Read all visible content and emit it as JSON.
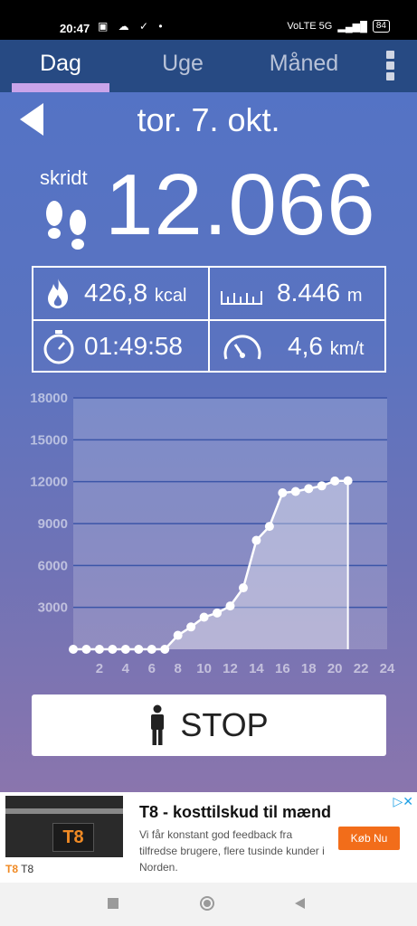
{
  "status_bar": {
    "time": "20:47",
    "left_icons": "▣ ☁ ✓ •",
    "network": "VoLTE 5G",
    "battery": "84"
  },
  "tabs": [
    {
      "label": "Dag",
      "active": true
    },
    {
      "label": "Uge",
      "active": false
    },
    {
      "label": "Måned",
      "active": false
    }
  ],
  "date": "tor. 7. okt.",
  "steps": {
    "label": "skridt",
    "value": "12.066"
  },
  "stats": {
    "calories": {
      "value": "426,8",
      "unit": "kcal"
    },
    "distance": {
      "value": "8.446",
      "unit": "m"
    },
    "duration": {
      "value": "01:49:58"
    },
    "speed": {
      "value": "4,6",
      "unit": "km/t"
    }
  },
  "chart_data": {
    "type": "area",
    "x": [
      0,
      1,
      2,
      3,
      4,
      5,
      6,
      7,
      8,
      9,
      10,
      11,
      12,
      13,
      14,
      15,
      16,
      17,
      18,
      19,
      20,
      21
    ],
    "y": [
      0,
      0,
      0,
      0,
      0,
      0,
      0,
      0,
      1000,
      1600,
      2300,
      2600,
      3100,
      4400,
      7800,
      8800,
      11200,
      11300,
      11500,
      11700,
      12050,
      12066
    ],
    "x_ticks": [
      "2",
      "4",
      "6",
      "8",
      "10",
      "12",
      "14",
      "16",
      "18",
      "20",
      "22",
      "24"
    ],
    "y_ticks": [
      "3000",
      "6000",
      "9000",
      "12000",
      "15000",
      "18000"
    ],
    "xlim": [
      0,
      24
    ],
    "ylim": [
      0,
      18000
    ],
    "grid": true
  },
  "stop_button": {
    "label": "STOP"
  },
  "ad": {
    "title": "T8 - kosttilskud til mænd",
    "description": "Vi får konstant god feedback fra tilfredse brugere, flere tusinde kunder i Norden.",
    "cta": "Køb Nu",
    "brand_logo": "T8",
    "brand_name": "T8",
    "image_text": "T8"
  },
  "colors": {
    "tab_bar": "#274a83",
    "accent_underline": "#c9a4ea",
    "chart_line": "#ffffff",
    "cta": "#f26d1a"
  }
}
